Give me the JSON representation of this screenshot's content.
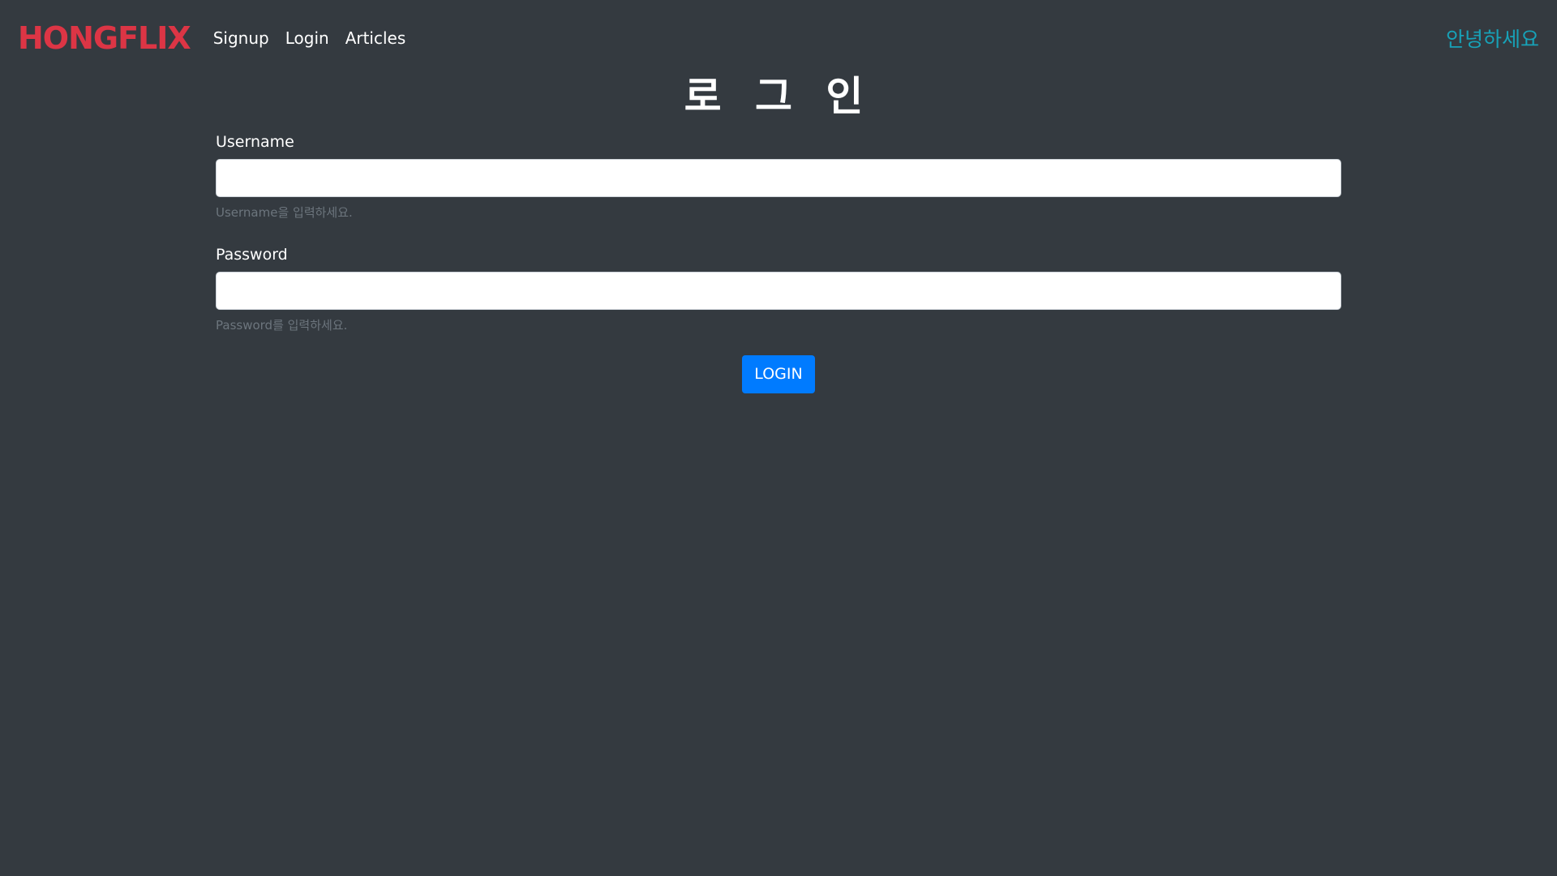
{
  "navbar": {
    "brand": "HONGFLIX",
    "links": [
      {
        "label": "Signup"
      },
      {
        "label": "Login"
      },
      {
        "label": "Articles"
      }
    ],
    "greeting": "안녕하세요"
  },
  "page": {
    "title": "로 그 인"
  },
  "form": {
    "username": {
      "label": "Username",
      "value": "",
      "help": "Username을 입력하세요."
    },
    "password": {
      "label": "Password",
      "value": "",
      "help": "Password를 입력하세요."
    },
    "submit_label": "LOGIN"
  },
  "colors": {
    "background": "#343a40",
    "brand": "#dc3545",
    "greeting": "#17a2b8",
    "primary_button": "#007bff",
    "help_text": "#6c757d"
  }
}
